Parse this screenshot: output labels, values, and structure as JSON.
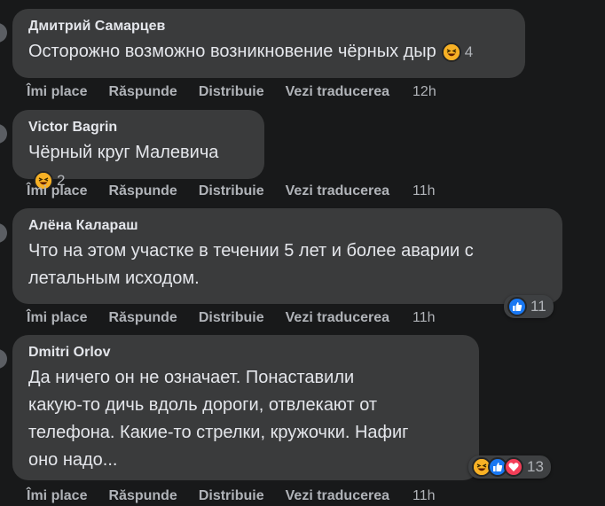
{
  "comments": [
    {
      "author": "Дмитрий Самарцев",
      "text": "Осторожно возможно возникновение чёрных дыр",
      "reaction_count": "4",
      "actions": {
        "like": "Îmi place",
        "reply": "Răspunde",
        "share": "Distribuie",
        "translate": "Vezi traducerea"
      },
      "time": "12h"
    },
    {
      "author": "Victor Bagrin",
      "text": "Чёрный круг Малевича",
      "reaction_count": "2",
      "actions": {
        "like": "Îmi place",
        "reply": "Răspunde",
        "share": "Distribuie",
        "translate": "Vezi traducerea"
      },
      "time": "11h"
    },
    {
      "author": "Алёна Калараш",
      "text_lines": [
        "Что на этом участке в течении 5 лет и более аварии с",
        "летальным исходом."
      ],
      "reaction_count": "11",
      "actions": {
        "like": "Îmi place",
        "reply": "Răspunde",
        "share": "Distribuie",
        "translate": "Vezi traducerea"
      },
      "time": "11h"
    },
    {
      "author": "Dmitri Orlov",
      "text_lines": [
        "Да ничего он не означает. Понаставили",
        "какую-то дичь вдоль дороги, отвлекают от",
        "телефона. Какие-то стрелки, кружочки. Нафиг",
        "оно надо..."
      ],
      "reaction_count": "13",
      "actions": {
        "like": "Îmi place",
        "reply": "Răspunde",
        "share": "Distribuie",
        "translate": "Vezi traducerea"
      },
      "time": "11h"
    }
  ],
  "reaction_icons": {
    "haha": "haha-face-icon",
    "like": "thumbs-up-icon",
    "love": "heart-icon"
  },
  "colors": {
    "background": "#18191a",
    "bubble": "#3a3b3c",
    "text": "#e4e6eb",
    "muted": "#b0b3b8",
    "haha": "#f7b125",
    "like": "#1877f2",
    "love": "#f33e58"
  }
}
